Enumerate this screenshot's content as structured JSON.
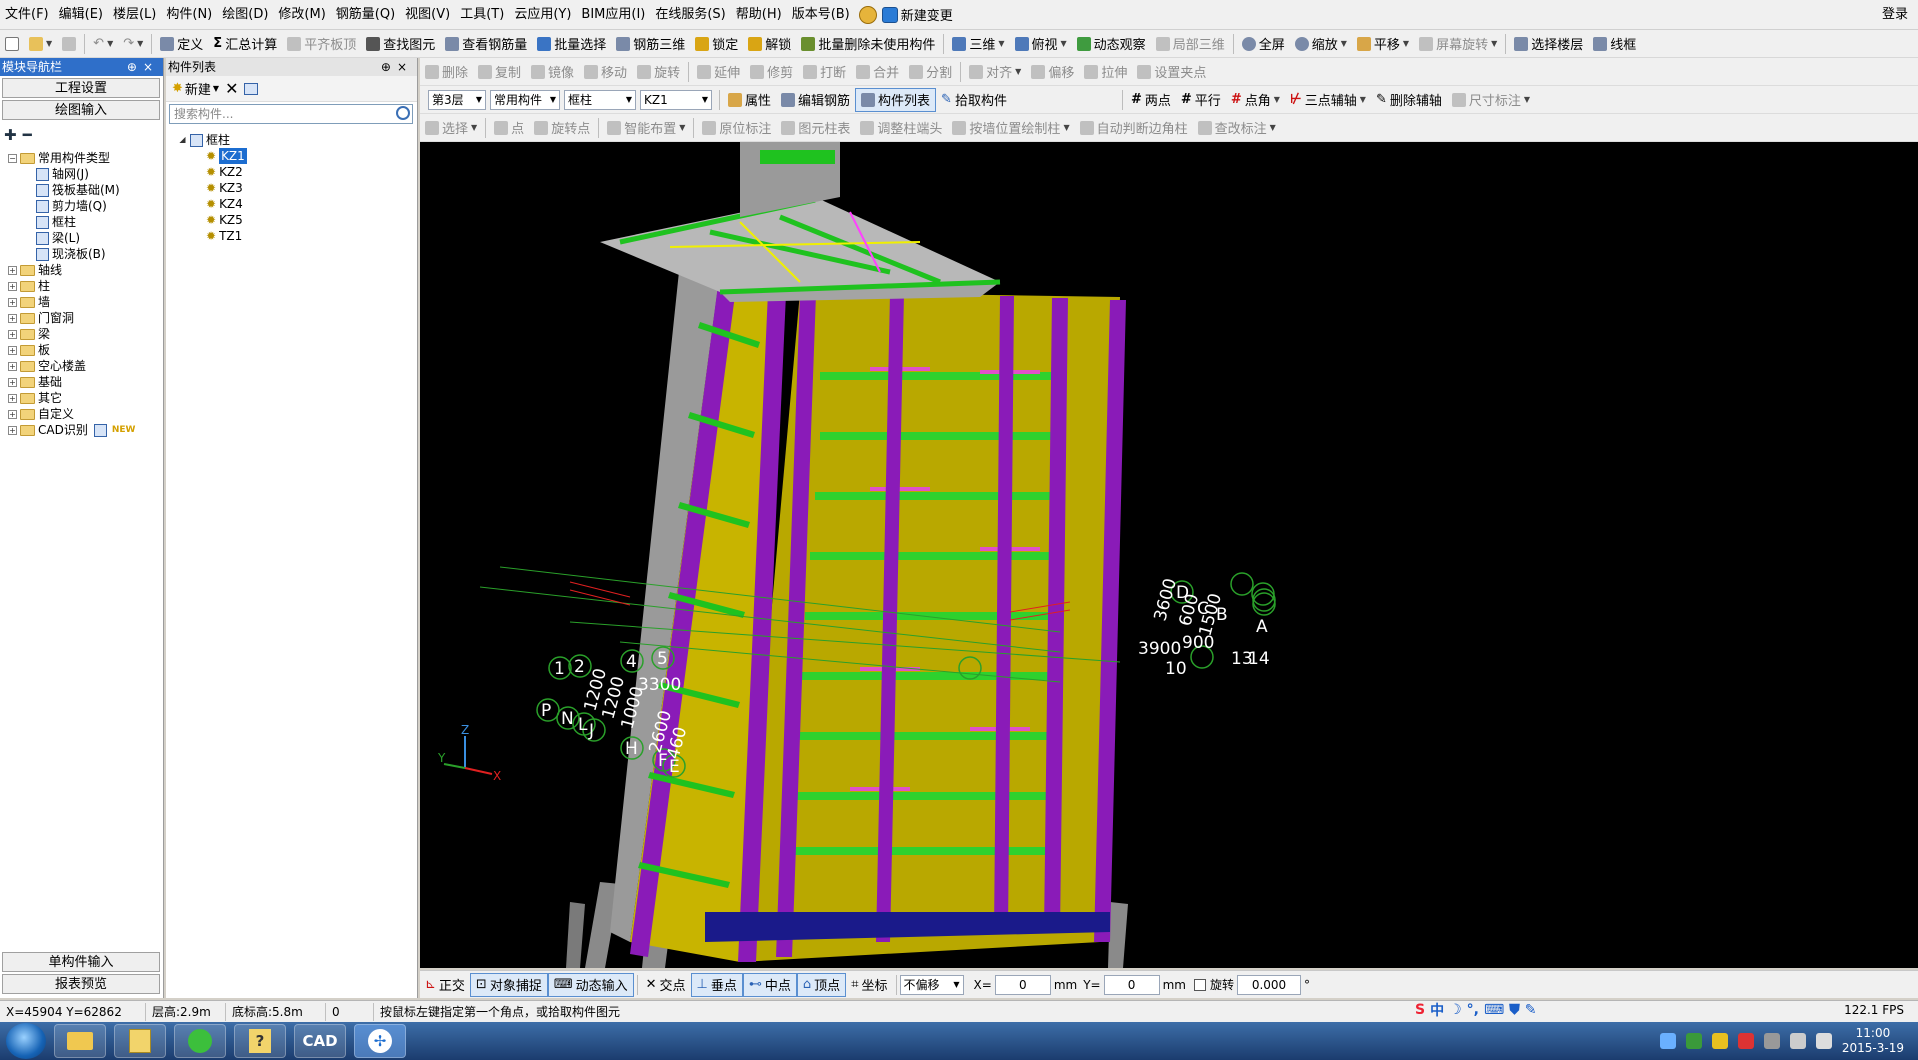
{
  "menu": {
    "items": [
      "文件(F)",
      "编辑(E)",
      "楼层(L)",
      "构件(N)",
      "绘图(D)",
      "修改(M)",
      "钢筋量(Q)",
      "视图(V)",
      "工具(T)",
      "云应用(Y)",
      "BIM应用(I)",
      "在线服务(S)",
      "帮助(H)",
      "版本号(B)"
    ],
    "new_change": "新建变更",
    "login": "登录"
  },
  "toolbar1": {
    "items": [
      "定义",
      "汇总计算",
      "平齐板顶",
      "查找图元",
      "查看钢筋量",
      "批量选择",
      "钢筋三维",
      "锁定",
      "解锁",
      "批量删除未使用构件",
      "三维",
      "俯视",
      "动态观察",
      "局部三维",
      "全屏",
      "缩放",
      "平移",
      "屏幕旋转",
      "选择楼层",
      "线框"
    ]
  },
  "nav_panel": {
    "title": "模块导航栏",
    "project_settings": "工程设置",
    "drawing_input": "绘图输入",
    "tree": [
      {
        "label": "常用构件类型",
        "level": 0,
        "expanded": true
      },
      {
        "label": "轴网(J)",
        "level": 1
      },
      {
        "label": "筏板基础(M)",
        "level": 1
      },
      {
        "label": "剪力墙(Q)",
        "level": 1
      },
      {
        "label": "框柱",
        "level": 1
      },
      {
        "label": "梁(L)",
        "level": 1
      },
      {
        "label": "现浇板(B)",
        "level": 1
      },
      {
        "label": "轴线",
        "level": 0
      },
      {
        "label": "柱",
        "level": 0
      },
      {
        "label": "墙",
        "level": 0
      },
      {
        "label": "门窗洞",
        "level": 0
      },
      {
        "label": "梁",
        "level": 0
      },
      {
        "label": "板",
        "level": 0
      },
      {
        "label": "空心楼盖",
        "level": 0
      },
      {
        "label": "基础",
        "level": 0
      },
      {
        "label": "其它",
        "level": 0
      },
      {
        "label": "自定义",
        "level": 0
      },
      {
        "label": "CAD识别",
        "level": 0,
        "badge": "NEW"
      }
    ],
    "single_component_input": "单构件输入",
    "report_preview": "报表预览"
  },
  "component_list": {
    "title": "构件列表",
    "new_label": "新建",
    "search_placeholder": "搜索构件...",
    "root": "框柱",
    "items": [
      "KZ1",
      "KZ2",
      "KZ3",
      "KZ4",
      "KZ5",
      "TZ1"
    ],
    "selected": "KZ1"
  },
  "toolbar2": {
    "items": [
      "删除",
      "复制",
      "镜像",
      "移动",
      "旋转",
      "延伸",
      "修剪",
      "打断",
      "合并",
      "分割",
      "对齐",
      "偏移",
      "拉伸",
      "设置夹点"
    ]
  },
  "toolbar3": {
    "floor": "第3层",
    "type": "常用构件",
    "category": "框柱",
    "component": "KZ1",
    "items": [
      "属性",
      "编辑钢筋",
      "构件列表",
      "拾取构件",
      "两点",
      "平行",
      "点角",
      "三点辅轴",
      "删除辅轴",
      "尺寸标注"
    ]
  },
  "toolbar4": {
    "items": [
      "选择",
      "点",
      "旋转点",
      "智能布置",
      "原位标注",
      "图元柱表",
      "调整柱端头",
      "按墙位置绘制柱",
      "自动判断边角柱",
      "查改标注"
    ]
  },
  "viewport": {
    "axis_labels_left": [
      "1",
      "2",
      "4",
      "5",
      "P",
      "N",
      "L",
      "J",
      "H",
      "F",
      "E"
    ],
    "dims_left": [
      "3300",
      "1200",
      "1200",
      "1000",
      "2600",
      "460"
    ],
    "axis_labels_right": [
      "D",
      "C",
      "B",
      "A",
      "10",
      "13",
      "14"
    ],
    "dims_right": [
      "3600",
      "600",
      "1500",
      "3900",
      "900"
    ],
    "axes": {
      "x": "X",
      "y": "Y",
      "z": "Z"
    }
  },
  "snapbar": {
    "items": [
      "正交",
      "对象捕捉",
      "动态输入",
      "交点",
      "垂点",
      "中点",
      "顶点",
      "坐标"
    ],
    "offset_mode": "不偏移",
    "x_label": "X=",
    "x_value": "0",
    "y_label": "Y=",
    "y_value": "0",
    "unit": "mm",
    "rotate_label": "旋转",
    "rotate_value": "0.000",
    "degree": "°"
  },
  "status": {
    "coords": "X=45904 Y=62862",
    "floor_height": "层高:2.9m",
    "base_elev": "底标高:5.8m",
    "count": "0",
    "prompt": "按鼠标左键指定第一个角点，或拾取构件图元",
    "fps": "122.1 FPS",
    "ime": "中"
  },
  "taskbar": {
    "cad_label": "CAD",
    "time": "11:00",
    "date": "2015-3-19"
  },
  "colors": {
    "wall_yellow": "#c8b400",
    "column_purple": "#8a1bb8",
    "beam_green": "#1fc21f",
    "roof_gray": "#b8b8b8",
    "nav_title_blue": "#2f6fc9"
  }
}
